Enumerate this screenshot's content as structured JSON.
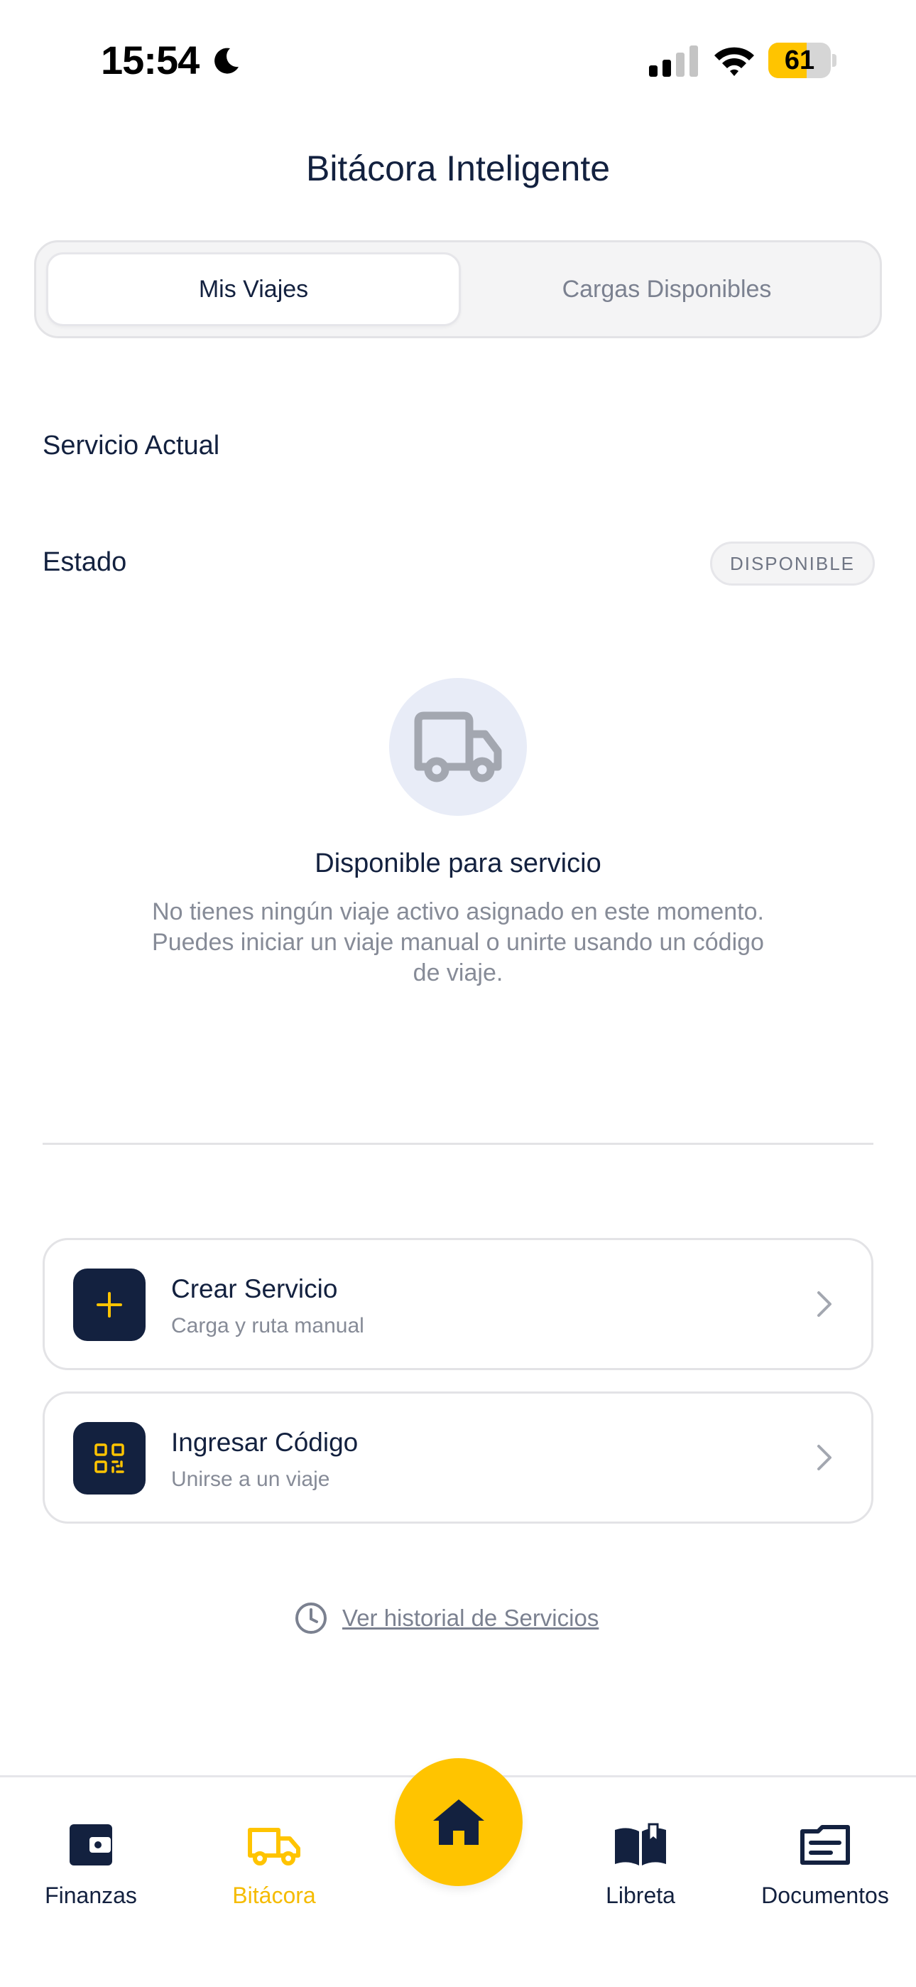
{
  "status_bar": {
    "time": "15:54",
    "battery": "61",
    "battery_level": 0.61
  },
  "header": {
    "title": "Bitácora Inteligente"
  },
  "segmented": {
    "tab_trips": "Mis Viajes",
    "tab_loads": "Cargas Disponibles"
  },
  "service": {
    "current_label": "Servicio Actual",
    "status_label": "Estado",
    "status_value": "DISPONIBLE"
  },
  "empty_state": {
    "title": "Disponible para servicio",
    "description": "No tienes ningún viaje activo asignado en este momento. Puedes iniciar un viaje manual o unirte usando un código de viaje."
  },
  "actions": {
    "create": {
      "title": "Crear Servicio",
      "subtitle": "Carga y ruta manual"
    },
    "code": {
      "title": "Ingresar Código",
      "subtitle": "Unirse a un viaje"
    }
  },
  "history": {
    "link": "Ver historial de Servicios"
  },
  "tab_bar": {
    "finanzas": "Finanzas",
    "bitacora": "Bitácora",
    "libreta": "Libreta",
    "documentos": "Documentos"
  },
  "colors": {
    "accent": "#ffc400",
    "navy": "#13213f",
    "muted": "#868b97"
  }
}
